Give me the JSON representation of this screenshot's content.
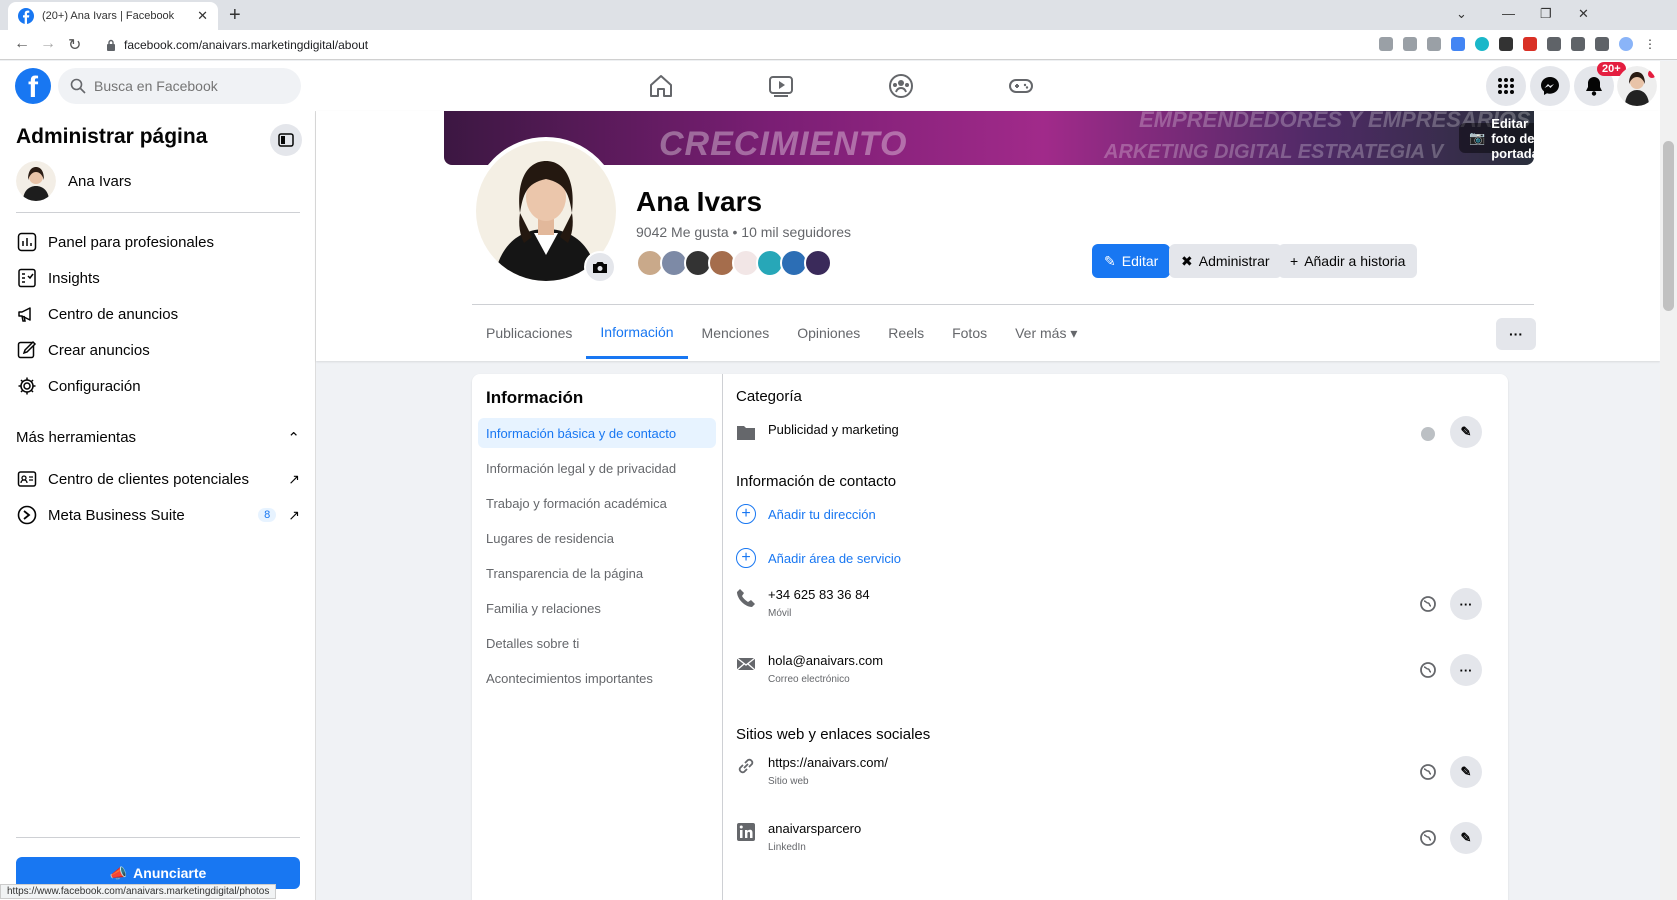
{
  "browser": {
    "tab_title": "(20+) Ana Ivars | Facebook",
    "url": "facebook.com/anaivars.marketingdigital/about",
    "status_url": "https://www.facebook.com/anaivars.marketingdigital/photos"
  },
  "fbnav": {
    "search_placeholder": "Busca en Facebook",
    "notif_count": "20+"
  },
  "sidebar": {
    "title": "Administrar página",
    "profile_name": "Ana Ivars",
    "items": [
      {
        "label": "Panel para profesionales",
        "icon": "dashboard-icon"
      },
      {
        "label": "Insights",
        "icon": "insights-icon"
      },
      {
        "label": "Centro de anuncios",
        "icon": "megaphone-icon"
      },
      {
        "label": "Crear anuncios",
        "icon": "pencil-square-icon"
      },
      {
        "label": "Configuración",
        "icon": "gear-icon"
      }
    ],
    "more_tools": "Más herramientas",
    "tools": [
      {
        "label": "Centro de clientes potenciales",
        "icon": "leads-icon"
      },
      {
        "label": "Meta Business Suite",
        "icon": "meta-icon",
        "count": "8"
      }
    ],
    "ad_button": "Anunciarte"
  },
  "profile": {
    "cover_button": "Editar foto de portada",
    "cover_text_1": "CRECIMIENTO",
    "cover_text_2": "EMPRENDEDORES Y EMPRESARIOS",
    "cover_text_3": "ARKETING DIGITAL  ESTRATEGIA V",
    "name": "Ana Ivars",
    "stats": "9042 Me gusta • 10 mil seguidores",
    "buttons": {
      "edit": "Editar",
      "manage": "Administrar",
      "story": "Añadir a historia"
    },
    "tabs": [
      "Publicaciones",
      "Información",
      "Menciones",
      "Opiniones",
      "Reels",
      "Fotos",
      "Ver más"
    ],
    "active_tab": "Información"
  },
  "info": {
    "heading": "Información",
    "nav": [
      "Información básica y de contacto",
      "Información legal y de privacidad",
      "Trabajo y formación académica",
      "Lugares de residencia",
      "Transparencia de la página",
      "Familia y relaciones",
      "Detalles sobre ti",
      "Acontecimientos importantes"
    ],
    "category_title": "Categoría",
    "category": "Publicidad y marketing",
    "contact_title": "Información de contacto",
    "add_address": "Añadir tu dirección",
    "add_service_area": "Añadir área de servicio",
    "phone": "+34 625 83 36 84",
    "phone_sub": "Móvil",
    "email": "hola@anaivars.com",
    "email_sub": "Correo electrónico",
    "web_title": "Sitios web y enlaces sociales",
    "website": "https://anaivars.com/",
    "website_sub": "Sitio web",
    "linkedin": "anaivarsparcero",
    "linkedin_sub": "LinkedIn"
  },
  "colors": {
    "brand": "#1877f2",
    "bg": "#f0f2f5",
    "badge": "#e41e3f"
  }
}
